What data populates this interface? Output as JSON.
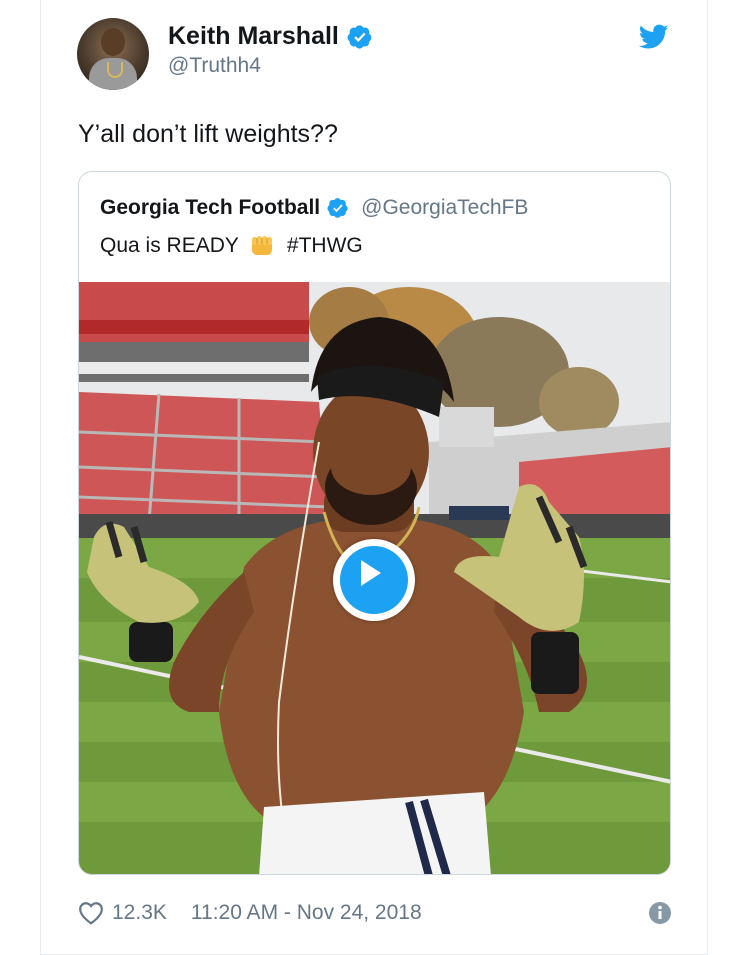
{
  "author": {
    "name": "Keith Marshall",
    "handle": "@Truthh4",
    "verified": true,
    "avatar_icon": "avatar-photo"
  },
  "tweet": {
    "text": "Y’all don’t lift weights??"
  },
  "quoted_tweet": {
    "name": "Georgia Tech Football",
    "handle": "@GeorgiaTechFB",
    "verified": true,
    "text_before": "Qua is READY",
    "emoji_icon": "raised-fist-emoji",
    "text_after": "#THWG",
    "media": {
      "type": "video",
      "play_icon": "play-icon"
    }
  },
  "footer": {
    "like_icon": "heart-icon",
    "likes": "12.3K",
    "timestamp": "11:20 AM - Nov 24, 2018",
    "info_icon": "info-icon"
  },
  "colors": {
    "accent": "#1da1f2",
    "text": "#14171a",
    "secondary": "#657786",
    "border": "#ccd6dd"
  }
}
